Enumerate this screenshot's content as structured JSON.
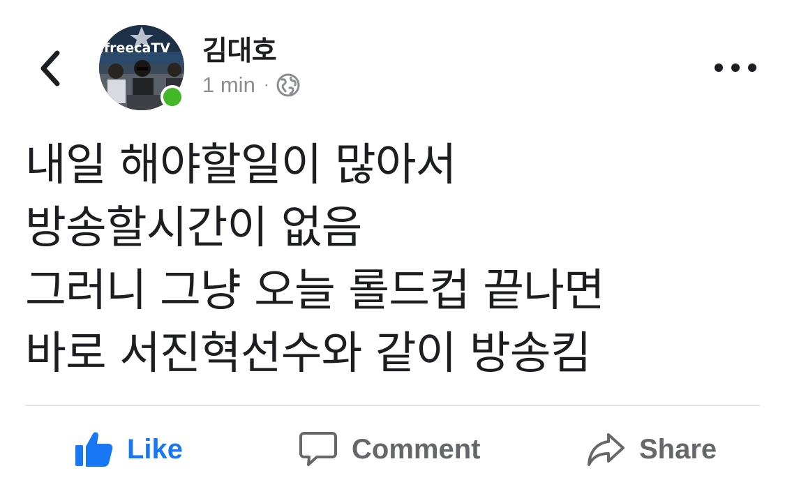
{
  "header": {
    "back_icon": "chevron-left-icon",
    "author_name": "김대호",
    "timestamp": "1 min",
    "separator": "·",
    "privacy_icon": "globe-icon",
    "more_icon": "more-horizontal-icon",
    "avatar_text": "afreecaTV",
    "online_status_color": "#42b72a"
  },
  "post": {
    "lines": [
      "내일 해야할일이 많아서",
      "방송할시간이 없음",
      "그러니 그냥 오늘 롤드컵 끝나면",
      "바로 서진혁선수와 같이 방송킴"
    ]
  },
  "actions": {
    "like_label": "Like",
    "comment_label": "Comment",
    "share_label": "Share",
    "like_color": "#1877f2",
    "muted_color": "#65676b"
  }
}
